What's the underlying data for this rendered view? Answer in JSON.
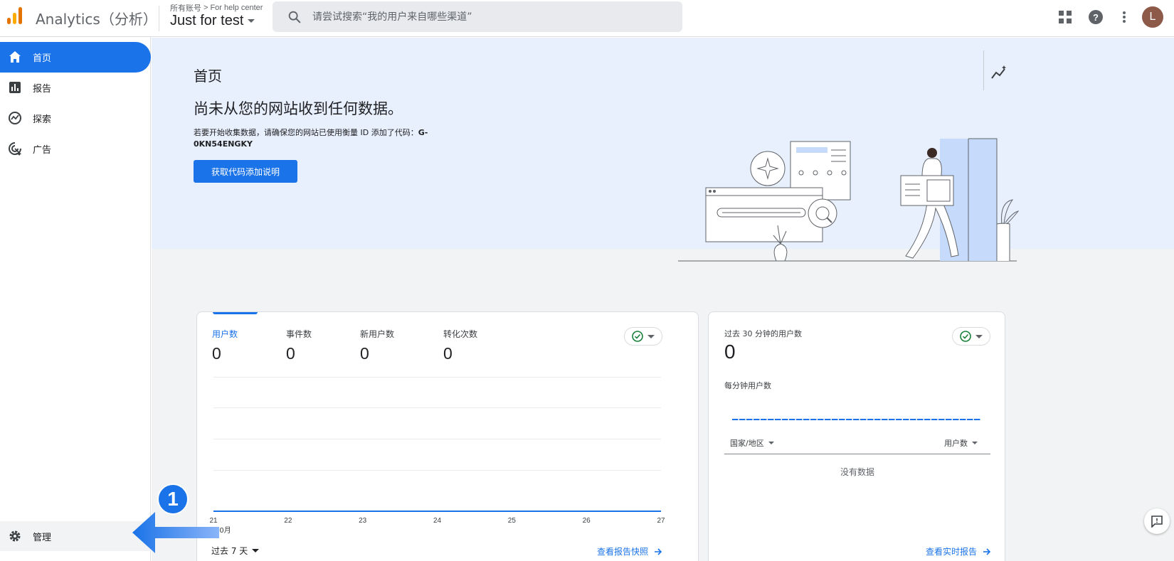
{
  "header": {
    "app_title": "Analytics（分析）",
    "breadcrumb_account": "所有账号",
    "breadcrumb_separator": ">",
    "breadcrumb_property_group": "For help center",
    "property_name": "Just for test",
    "search_placeholder": "请尝试搜索“我的用户来自哪些渠道”",
    "avatar_initial": "L",
    "icons": [
      "apps-grid-icon",
      "help-icon",
      "more-vert-icon"
    ]
  },
  "sidebar": {
    "items": [
      {
        "label": "首页",
        "icon": "home-icon",
        "active": true
      },
      {
        "label": "报告",
        "icon": "bar-chart-icon",
        "active": false
      },
      {
        "label": "探索",
        "icon": "explore-icon",
        "active": false
      },
      {
        "label": "广告",
        "icon": "ads-icon",
        "active": false
      }
    ],
    "admin_label": "管理"
  },
  "annotation": {
    "step_number": "1"
  },
  "hero": {
    "page_title": "首页",
    "heading": "尚未从您的网站收到任何数据。",
    "description": "若要开始收集数据，请确保您的网站已使用衡量 ID 添加了代码：",
    "measurement_id": "G-0KN54ENGKY",
    "button_label": "获取代码添加说明"
  },
  "overview_card": {
    "metrics": [
      {
        "label": "用户数",
        "value": "0",
        "active": true
      },
      {
        "label": "事件数",
        "value": "0",
        "active": false
      },
      {
        "label": "新用户数",
        "value": "0",
        "active": false
      },
      {
        "label": "转化次数",
        "value": "0",
        "active": false
      }
    ],
    "x_ticks": [
      "21",
      "22",
      "23",
      "24",
      "25",
      "26",
      "27"
    ],
    "x_month": "10月",
    "range_label": "过去 7 天",
    "link_label": "查看报告快照"
  },
  "chart_data": {
    "type": "line",
    "categories": [
      "21",
      "22",
      "23",
      "24",
      "25",
      "26",
      "27"
    ],
    "series": [
      {
        "name": "用户数",
        "values": [
          0,
          0,
          0,
          0,
          0,
          0,
          0
        ]
      }
    ],
    "xlabel": "10月",
    "ylabel": "",
    "grid": true
  },
  "realtime_card": {
    "title": "过去 30 分钟的用户数",
    "value": "0",
    "subtitle": "每分钟用户数",
    "col_country": "国家/地区",
    "col_users": "用户数",
    "empty_text": "没有数据",
    "link_label": "查看实时报告"
  },
  "colors": {
    "accent": "#1a73e8",
    "hero_bg": "#e8f0fe",
    "page_bg": "#f1f3f4",
    "success": "#188038"
  }
}
